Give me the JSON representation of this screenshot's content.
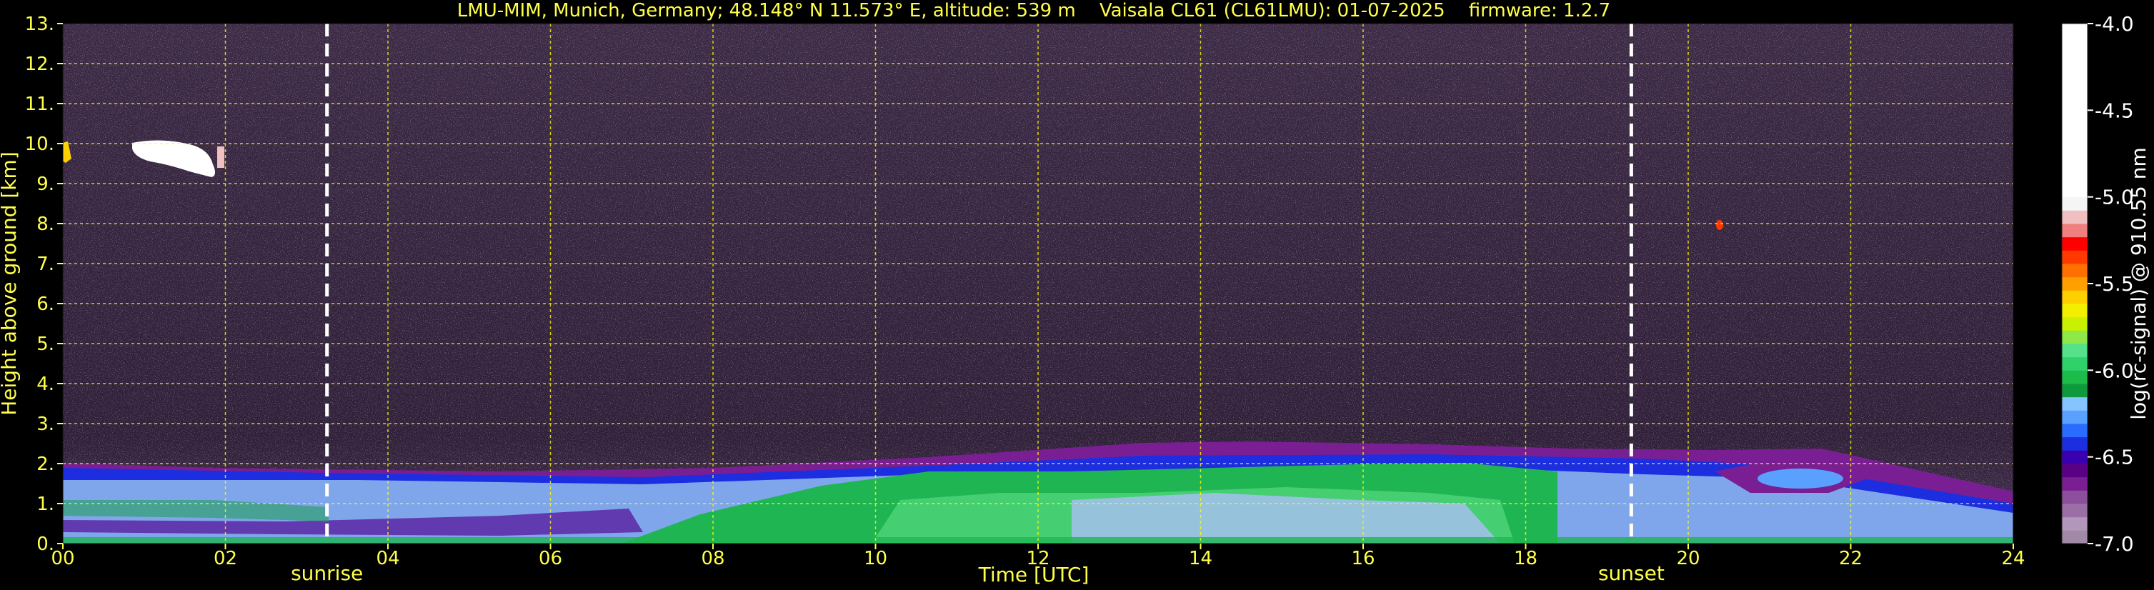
{
  "chart_data": {
    "type": "heatmap",
    "title": "LMU-MIM, Munich, Germany; 48.148° N 11.573° E, altitude: 539 m    Vaisala CL61 (CL61LMU): 01-07-2025    firmware: 1.2.7",
    "xlabel": "Time [UTC]",
    "ylabel": "Height above ground [km]",
    "xlim": [
      0,
      24
    ],
    "ylim": [
      0,
      13
    ],
    "x_ticks": [
      0,
      2,
      4,
      6,
      8,
      10,
      12,
      14,
      16,
      18,
      20,
      22,
      24
    ],
    "x_tick_labels": [
      "00",
      "02",
      "04",
      "06",
      "08",
      "10",
      "12",
      "14",
      "16",
      "18",
      "20",
      "22",
      "24"
    ],
    "y_ticks": [
      0,
      1,
      2,
      3,
      4,
      5,
      6,
      7,
      8,
      9,
      10,
      11,
      12,
      13
    ],
    "y_tick_labels": [
      "0.",
      "1.",
      "2.",
      "3.",
      "4.",
      "5.",
      "6.",
      "7.",
      "8.",
      "9.",
      "10.",
      "11.",
      "12.",
      "13."
    ],
    "grid": true,
    "colorbar": {
      "label": "log(rc-signal) @ 910.55 nm",
      "range": [
        -7.0,
        -4.0
      ],
      "ticks": [
        -4.0,
        -4.5,
        -5.0,
        -5.5,
        -6.0,
        -6.5,
        -7.0
      ],
      "tick_labels": [
        "-4.0",
        "-4.5",
        "-5.0",
        "-5.5",
        "-6.0",
        "-6.5",
        "-7.0"
      ],
      "colors": [
        "#a08aa5",
        "#b397ba",
        "#9a6fa5",
        "#8c4f9c",
        "#7a1f93",
        "#5a0085",
        "#3a00b0",
        "#1c2ee0",
        "#2a6cff",
        "#5aa0ff",
        "#86c4ff",
        "#0e9a3c",
        "#1dbb4a",
        "#2fd16a",
        "#55e08a",
        "#8ee84a",
        "#c8f000",
        "#f2f000",
        "#ffd000",
        "#ffa000",
        "#ff7000",
        "#ff3a00",
        "#ff0000",
        "#f08080",
        "#f0c0c0",
        "#f5f5f5",
        "#ffffff"
      ]
    },
    "markers": [
      {
        "label": "sunrise",
        "x": 3.25
      },
      {
        "label": "sunset",
        "x": 19.3
      }
    ],
    "features": [
      {
        "label": "",
        "description": "high cloud",
        "x_range": [
          0.8,
          2.05
        ],
        "height_km": [
          9.4,
          9.9
        ]
      },
      {
        "label": "",
        "description": "aerosol layer top",
        "height_km": [
          1.8,
          2.3
        ]
      }
    ]
  }
}
